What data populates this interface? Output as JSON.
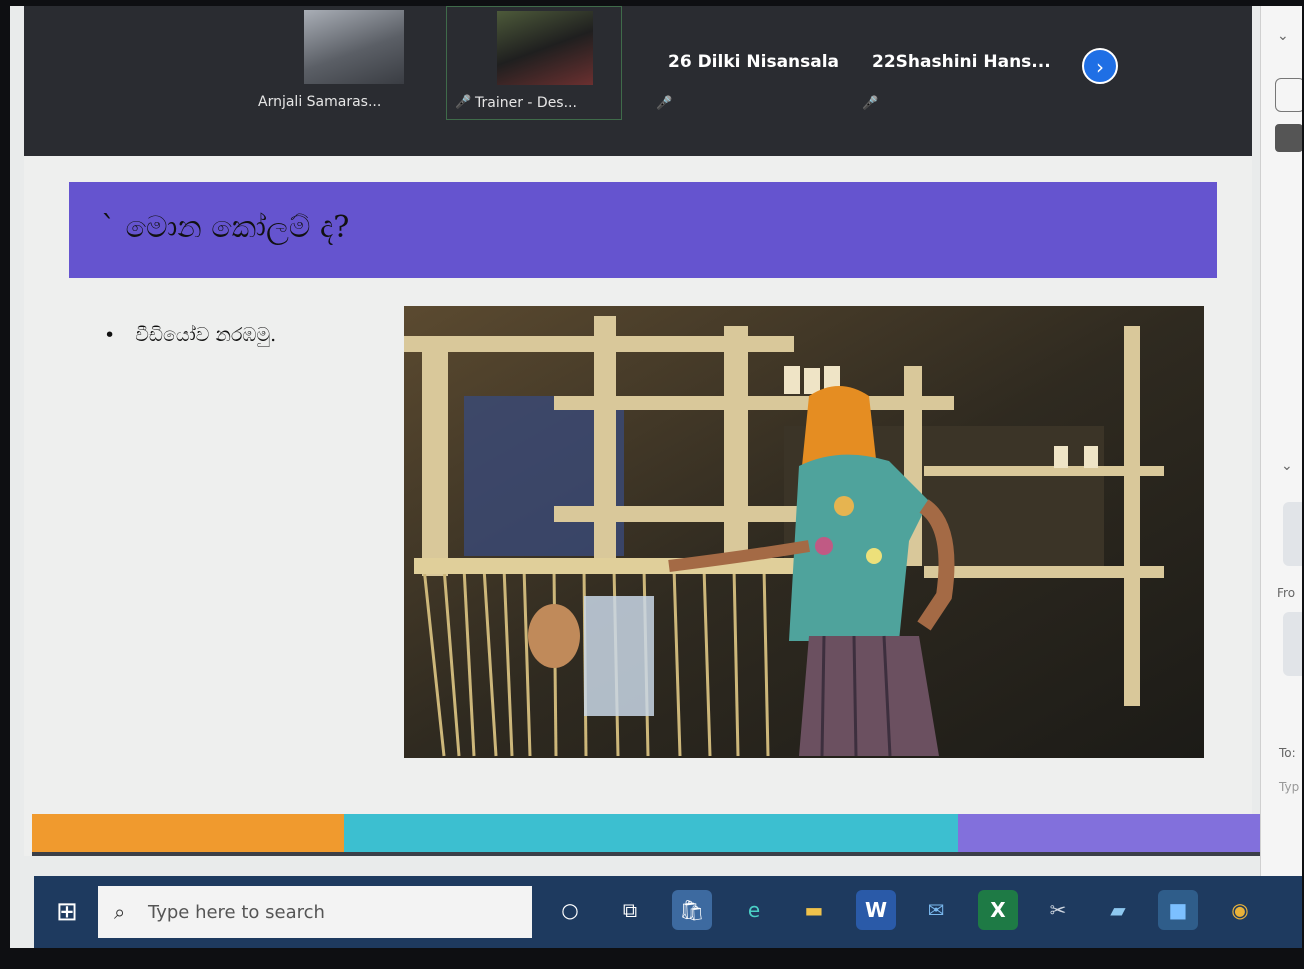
{
  "participants": [
    {
      "name": "Arnjali Samaras..."
    },
    {
      "name": "Trainer - Des..."
    },
    {
      "name": "26  Dilki Nisansala"
    },
    {
      "name": "22Shashini  Hans..."
    }
  ],
  "chat_panel": {
    "from_label": "Fro",
    "to_label": "To:",
    "type_placeholder": "Typ"
  },
  "slide": {
    "title": "` මොන කෝලම් ද?",
    "bullet": "වීඩියෝව නරඹමු.",
    "photo_alt": "woman weaving at a bamboo loom",
    "bottom_bar_colors": [
      "#f09a2e",
      "#3cbfd0",
      "#8270dc"
    ]
  },
  "taskbar": {
    "search_placeholder": "Type here to search",
    "apps": [
      {
        "icon": "cortana-circle-icon"
      },
      {
        "icon": "task-view-icon"
      },
      {
        "icon": "microsoft-store-icon"
      },
      {
        "icon": "edge-icon"
      },
      {
        "icon": "file-explorer-icon"
      },
      {
        "icon": "word-icon"
      },
      {
        "icon": "mail-icon"
      },
      {
        "icon": "excel-icon"
      },
      {
        "icon": "snipping-tool-icon"
      },
      {
        "icon": "app-icon"
      },
      {
        "icon": "zoom-icon"
      },
      {
        "icon": "chrome-icon"
      }
    ]
  },
  "colors": {
    "banner": "#6554cf",
    "zoom_strip": "#2a2c31",
    "taskbar": "#1e3a5f",
    "next_button": "#1f6fe5"
  }
}
